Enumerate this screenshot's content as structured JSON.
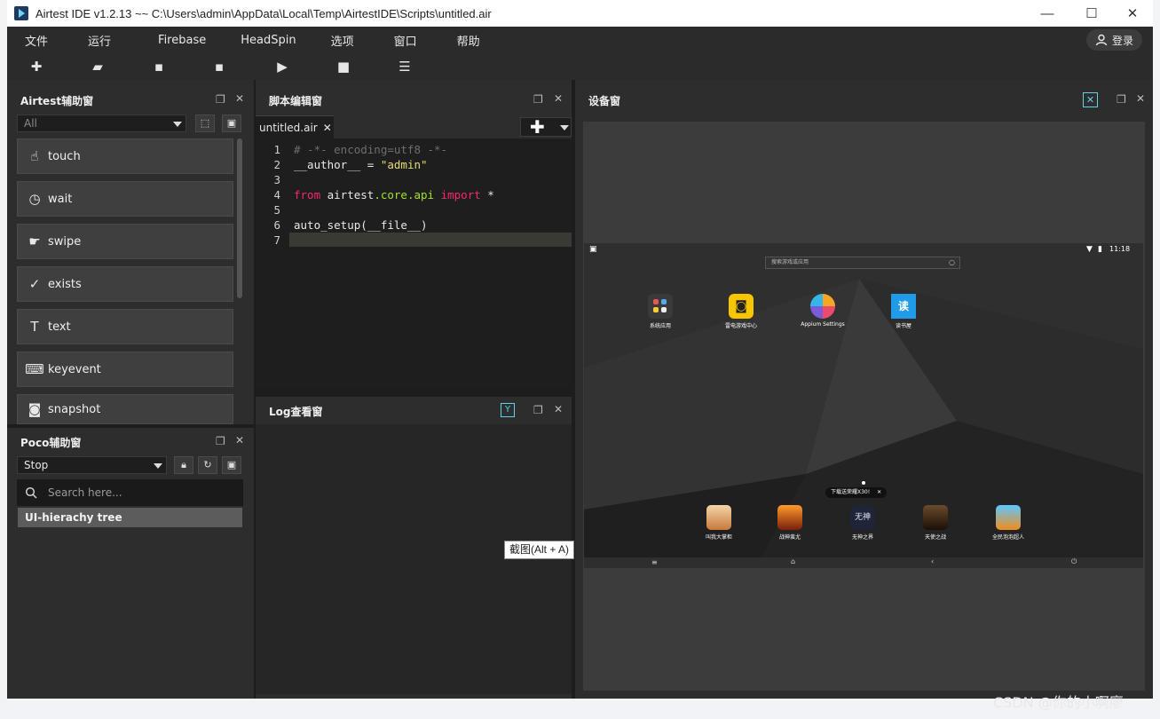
{
  "window": {
    "title": "Airtest IDE v1.2.13 ~~ C:\\Users\\admin\\AppData\\Local\\Temp\\AirtestIDE\\Scripts\\untitled.air",
    "minimize": "—",
    "maximize": "☐",
    "close": "✕"
  },
  "menu": [
    "文件",
    "运行",
    "Firebase",
    "HeadSpin",
    "选项",
    "窗口",
    "帮助"
  ],
  "login_label": "登录",
  "toolbar": {
    "new": "✚",
    "open": "▰",
    "save": "▪",
    "save_as": "▪",
    "run": "▶",
    "stop": "■",
    "log": "☰"
  },
  "airtest_panel": {
    "title": "Airtest辅助窗",
    "filter_value": "All",
    "items": [
      {
        "label": "touch",
        "icon": "touch-icon",
        "glyph": "☝"
      },
      {
        "label": "wait",
        "icon": "clock-icon",
        "glyph": "◷"
      },
      {
        "label": "swipe",
        "icon": "swipe-icon",
        "glyph": "☛"
      },
      {
        "label": "exists",
        "icon": "check-circle-icon",
        "glyph": "✓"
      },
      {
        "label": "text",
        "icon": "text-box-icon",
        "glyph": "T"
      },
      {
        "label": "keyevent",
        "icon": "keyboard-icon",
        "glyph": "⌨"
      },
      {
        "label": "snapshot",
        "icon": "camera-icon",
        "glyph": "◙"
      }
    ]
  },
  "poco_panel": {
    "title": "Poco辅助窗",
    "mode_value": "Stop",
    "search_placeholder": "Search here...",
    "tree_header": "UI-hierachy tree"
  },
  "editor_panel": {
    "title": "脚本编辑窗",
    "tab_label": "untitled.air",
    "tab_close": "✕",
    "add_label": "✚",
    "line_numbers": [
      "1",
      "2",
      "3",
      "4",
      "5",
      "6",
      "7"
    ],
    "lines": {
      "l1": "# -*- encoding=utf8 -*-",
      "l2_a": "__author__ = ",
      "l2_b": "\"admin\"",
      "l4_a": "from",
      "l4_b": " airtest",
      "l4_c": ".core.api",
      "l4_d": " import",
      "l4_e": " *",
      "l6": "auto_setup(__file__)"
    }
  },
  "log_panel": {
    "title": "Log查看窗"
  },
  "device_panel": {
    "title": "设备窗",
    "status_time": "11:18",
    "search_placeholder": "搜索游戏或应用",
    "apps_top": [
      {
        "label": "系统应用"
      },
      {
        "label": "雷电游戏中心"
      },
      {
        "label": "Appium Settings"
      },
      {
        "label": "读书屋",
        "glyph": "读"
      }
    ],
    "banner": "下载送荣耀X30!",
    "banner_close": "✕",
    "apps_bottom": [
      {
        "label": "叫我大掌柜"
      },
      {
        "label": "战神蚩尤"
      },
      {
        "label": "无神之界",
        "glyph": "无神"
      },
      {
        "label": "天使之战"
      },
      {
        "label": "全民泡泡超人"
      }
    ],
    "nav": [
      "≡",
      "⌂",
      "‹",
      "⏻"
    ]
  },
  "tooltip": "截图(Alt + A)",
  "watermark": "CSDN @你的小啊廖",
  "colors": {
    "workarea": "#1d1d1d",
    "panel": "#2d2d2d",
    "accent_icon": "#5fd1e8"
  }
}
